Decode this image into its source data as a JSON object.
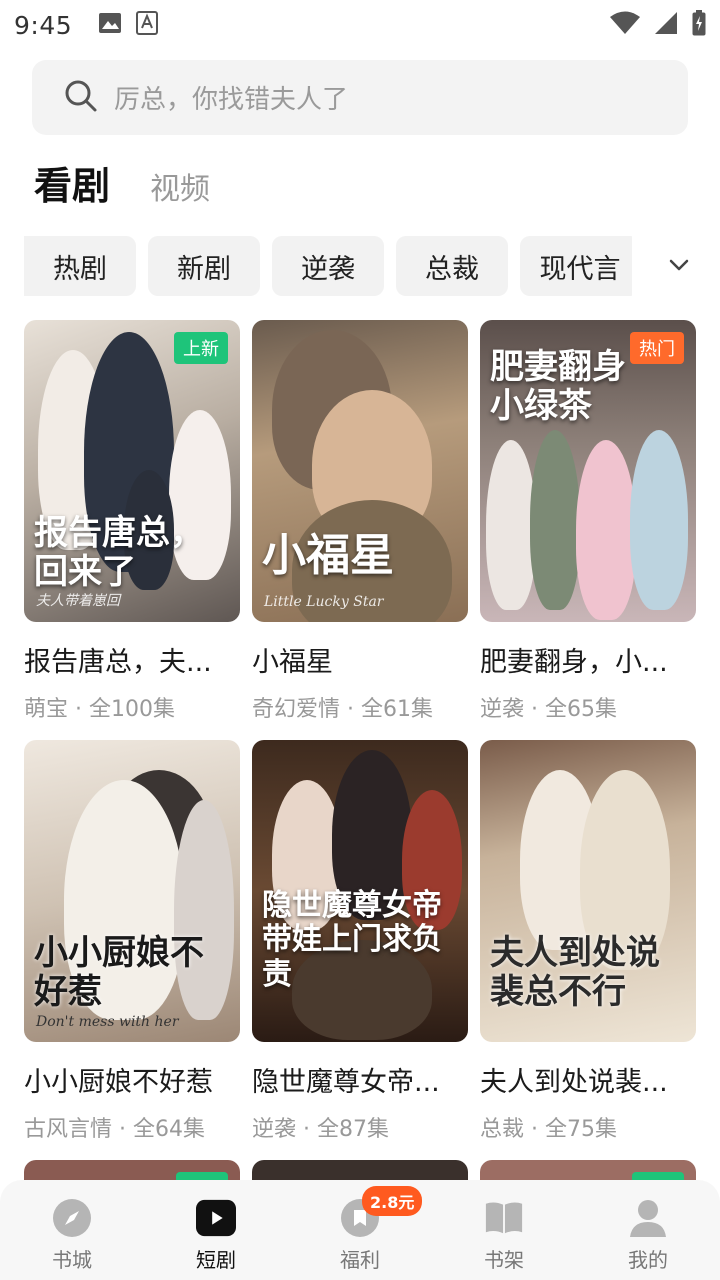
{
  "status_bar": {
    "time": "9:45"
  },
  "search": {
    "placeholder": "厉总，你找错夫人了"
  },
  "main_tabs": [
    {
      "label": "看剧"
    },
    {
      "label": "视频"
    }
  ],
  "chips": [
    {
      "label": "热剧"
    },
    {
      "label": "新剧"
    },
    {
      "label": "逆袭"
    },
    {
      "label": "总裁"
    },
    {
      "label": "现代言"
    }
  ],
  "dramas": [
    {
      "title": "报告唐总，夫...",
      "meta": "萌宝 · 全100集",
      "badge": "上新",
      "poster_text": "报告唐总，回来了",
      "poster_sub": "夫人带着崽回",
      "colors": [
        "#cfc3b5",
        "#7c6f66"
      ]
    },
    {
      "title": "小福星",
      "meta": "奇幻爱情 · 全61集",
      "badge": "",
      "poster_text": "小福星",
      "poster_sub": "Little Lucky Star",
      "colors": [
        "#b9a184",
        "#5c4a3b"
      ]
    },
    {
      "title": "肥妻翻身，小...",
      "meta": "逆袭 · 全65集",
      "badge": "热门",
      "poster_text": "肥妻翻身小绿茶",
      "poster_sub": "",
      "colors": [
        "#8a7f78",
        "#d6cfd3"
      ]
    },
    {
      "title": "小小厨娘不好惹",
      "meta": "古风言情 · 全64集",
      "badge": "",
      "poster_text": "小小厨娘不好惹",
      "poster_sub": "Don't mess with her",
      "colors": [
        "#dcd3c4",
        "#8e7b6a"
      ]
    },
    {
      "title": "隐世魔尊女帝...",
      "meta": "逆袭 · 全87集",
      "badge": "",
      "poster_text": "隐世魔尊女帝带娃上门求负责",
      "poster_sub": "",
      "colors": [
        "#5a3a26",
        "#2a1a12"
      ]
    },
    {
      "title": "夫人到处说裴...",
      "meta": "总裁 · 全75集",
      "badge": "",
      "poster_text": "夫人到处说裴总不行",
      "poster_sub": "",
      "colors": [
        "#c9b9a2",
        "#e7ddd0"
      ]
    }
  ],
  "bottom_nav": [
    {
      "label": "书城",
      "icon": "compass-icon"
    },
    {
      "label": "短剧",
      "icon": "play-icon"
    },
    {
      "label": "福利",
      "icon": "reward-icon",
      "badge": "2.8元"
    },
    {
      "label": "书架",
      "icon": "book-icon"
    },
    {
      "label": "我的",
      "icon": "profile-icon"
    }
  ],
  "colors": {
    "new_badge": "#1ec47a",
    "hot_badge": "#ff6a2b",
    "reward_badge": "#ff5a1f"
  }
}
